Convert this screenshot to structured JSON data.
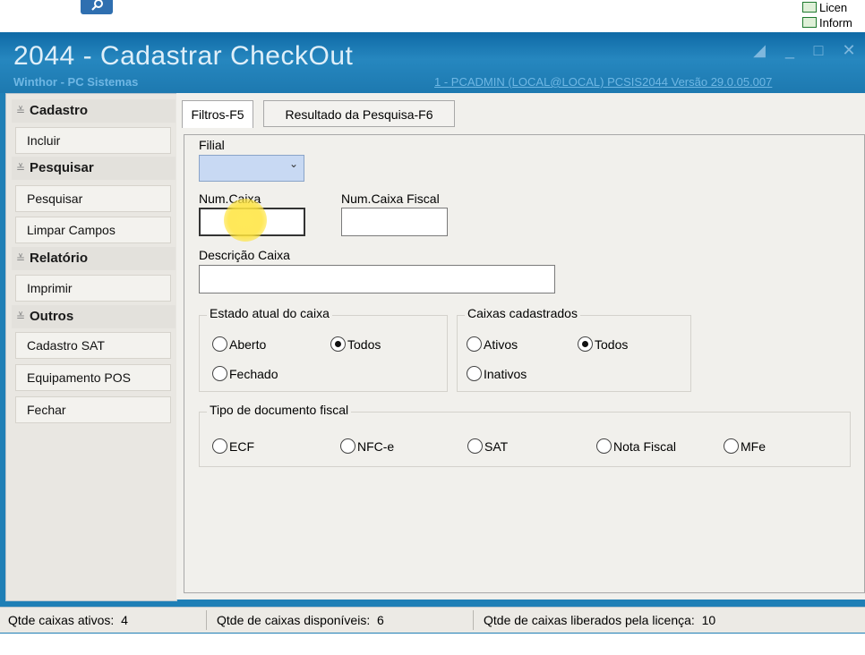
{
  "top": {
    "links": [
      "Licen",
      "Inform"
    ]
  },
  "window": {
    "title": "2044 - Cadastrar CheckOut",
    "subtitle": "Winthor - PC Sistemas",
    "session": "1 - PCADMIN (LOCAL@LOCAL)   PCSIS2044  Versão  29.0.05.007"
  },
  "sidebar": {
    "sections": [
      {
        "title": "Cadastro",
        "items": [
          "Incluir"
        ]
      },
      {
        "title": "Pesquisar",
        "items": [
          "Pesquisar",
          "Limpar Campos"
        ]
      },
      {
        "title": "Relatório",
        "items": [
          "Imprimir"
        ]
      },
      {
        "title": "Outros",
        "items": [
          "Cadastro SAT",
          "Equipamento POS",
          "Fechar"
        ]
      }
    ]
  },
  "tabs": [
    "Filtros-F5",
    "Resultado da Pesquisa-F6"
  ],
  "form": {
    "filial_label": "Filial",
    "filial_value": "",
    "num_caixa_label": "Num.Caixa",
    "num_caixa_value": "",
    "num_caixa_fiscal_label": "Num.Caixa Fiscal",
    "num_caixa_fiscal_value": "",
    "descricao_label": "Descrição Caixa",
    "descricao_value": "",
    "estado": {
      "title": "Estado atual do caixa",
      "options": [
        "Aberto",
        "Todos",
        "Fechado"
      ],
      "selected": "Todos"
    },
    "caixas": {
      "title": "Caixas cadastrados",
      "options": [
        "Ativos",
        "Todos",
        "Inativos"
      ],
      "selected": "Todos"
    },
    "tipo_doc": {
      "title": "Tipo de documento fiscal",
      "options": [
        "ECF",
        "NFC-e",
        "SAT",
        "Nota Fiscal",
        "MFe"
      ],
      "selected": ""
    }
  },
  "status": {
    "ativos_label": "Qtde caixas ativos:",
    "ativos_value": "4",
    "disponiveis_label": "Qtde de caixas disponíveis:",
    "disponiveis_value": "6",
    "licenca_label": "Qtde de caixas liberados pela licença:",
    "licenca_value": "10"
  },
  "colors": {
    "title_bar": "#1f7fb6",
    "panel": "#f1f0ec",
    "select_fill": "#c8d9f3"
  }
}
